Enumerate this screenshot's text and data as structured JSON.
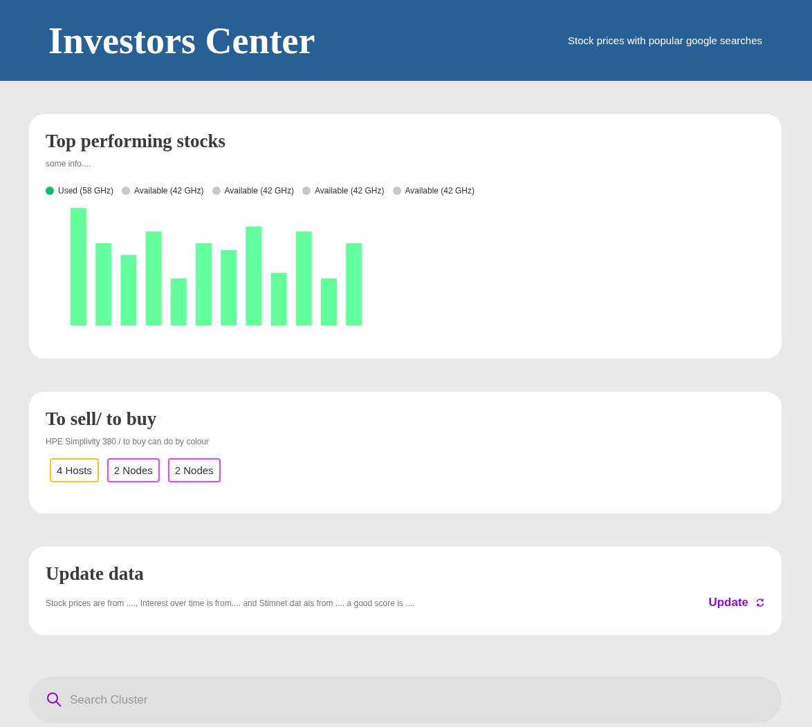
{
  "header": {
    "title": "Investors Center",
    "subtitle": "Stock prices with popular google searches"
  },
  "top_stocks": {
    "title": "Top performing stocks",
    "info": "some info....",
    "legend": [
      {
        "label": "Used (58 GHz)",
        "color": "#0cc06a"
      },
      {
        "label": "Available (42 GHz)",
        "color": "#c8c8c8"
      },
      {
        "label": "Available (42 GHz)",
        "color": "#c8c8c8"
      },
      {
        "label": "Available (42 GHz)",
        "color": "#c8c8c8"
      },
      {
        "label": "Available (42 GHz)",
        "color": "#c8c8c8"
      }
    ]
  },
  "sell_buy": {
    "title": "To sell/ to buy",
    "info": "HPE Simplivity 380 / to buy can do by colour",
    "tags": [
      {
        "label": "4 Hosts",
        "color": "#f5c518"
      },
      {
        "label": "2 Nodes",
        "color": "#f73cf0"
      },
      {
        "label": "2 Nodes",
        "color": "#f73cf0"
      }
    ]
  },
  "update": {
    "title": "Update data",
    "info": "Stock prices are from ...., Interest over time is from.... and Stimnet dat ais from .... a good score is ....",
    "button": "Update"
  },
  "search": {
    "placeholder": "Search Cluster"
  }
}
